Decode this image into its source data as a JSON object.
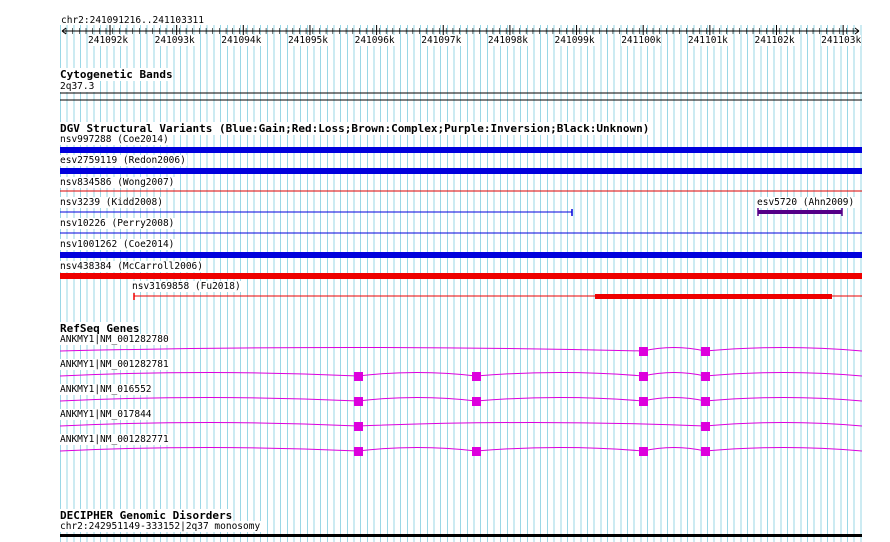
{
  "ruler": {
    "position": "chr2:241091216..241103311",
    "ticks": [
      {
        "label": "241092k",
        "kb": 241092
      },
      {
        "label": "241093k",
        "kb": 241093
      },
      {
        "label": "241094k",
        "kb": 241094
      },
      {
        "label": "241095k",
        "kb": 241095
      },
      {
        "label": "241096k",
        "kb": 241096
      },
      {
        "label": "241097k",
        "kb": 241097
      },
      {
        "label": "241098k",
        "kb": 241098
      },
      {
        "label": "241099k",
        "kb": 241099
      },
      {
        "label": "241100k",
        "kb": 241100
      },
      {
        "label": "241101k",
        "kb": 241101
      },
      {
        "label": "241102k",
        "kb": 241102
      },
      {
        "label": "241103k",
        "kb": 241103
      }
    ]
  },
  "cytoband": {
    "title": "Cytogenetic Bands",
    "band": "2q37.3"
  },
  "dgv": {
    "title": "DGV Structural Variants (Blue:Gain;Red:Loss;Brown:Complex;Purple:Inversion;Black:Unknown)",
    "variants": [
      {
        "label": "nsv997288 (Coe2014)",
        "color": "#0000dd",
        "style": "thick"
      },
      {
        "label": "esv2759119 (Redon2006)",
        "color": "#0000dd",
        "style": "thick"
      },
      {
        "label": "nsv834586 (Wong2007)",
        "color": "#dd0000",
        "style": "thin"
      },
      {
        "label": "nsv3239 (Kidd2008)",
        "color": "#0000dd",
        "style": "partial"
      },
      {
        "label": "esv5720 (Ahn2009)",
        "color": "#550088",
        "style": "inversion"
      },
      {
        "label": "nsv10226 (Perry2008)",
        "color": "#0000dd",
        "style": "thin"
      },
      {
        "label": "nsv1001262 (Coe2014)",
        "color": "#0000dd",
        "style": "thick"
      },
      {
        "label": "nsv438384 (McCarroll2006)",
        "color": "#ee0000",
        "style": "thick"
      },
      {
        "label": "nsv3169858 (Fu2018)",
        "color": "#ee0000",
        "style": "partial-thick"
      }
    ]
  },
  "refseq": {
    "title": "RefSeq Genes",
    "color": "#dd00dd",
    "genes": [
      {
        "label": "ANKMY1|NM_001282780"
      },
      {
        "label": "ANKMY1|NM_001282781"
      },
      {
        "label": "ANKMY1|NM_016552"
      },
      {
        "label": "ANKMY1|NM_017844"
      },
      {
        "label": "ANKMY1|NM_001282771"
      }
    ]
  },
  "decipher": {
    "title": "DECIPHER Genomic Disorders",
    "item": "chr2:242951149-333152|2q37 monosomy"
  }
}
